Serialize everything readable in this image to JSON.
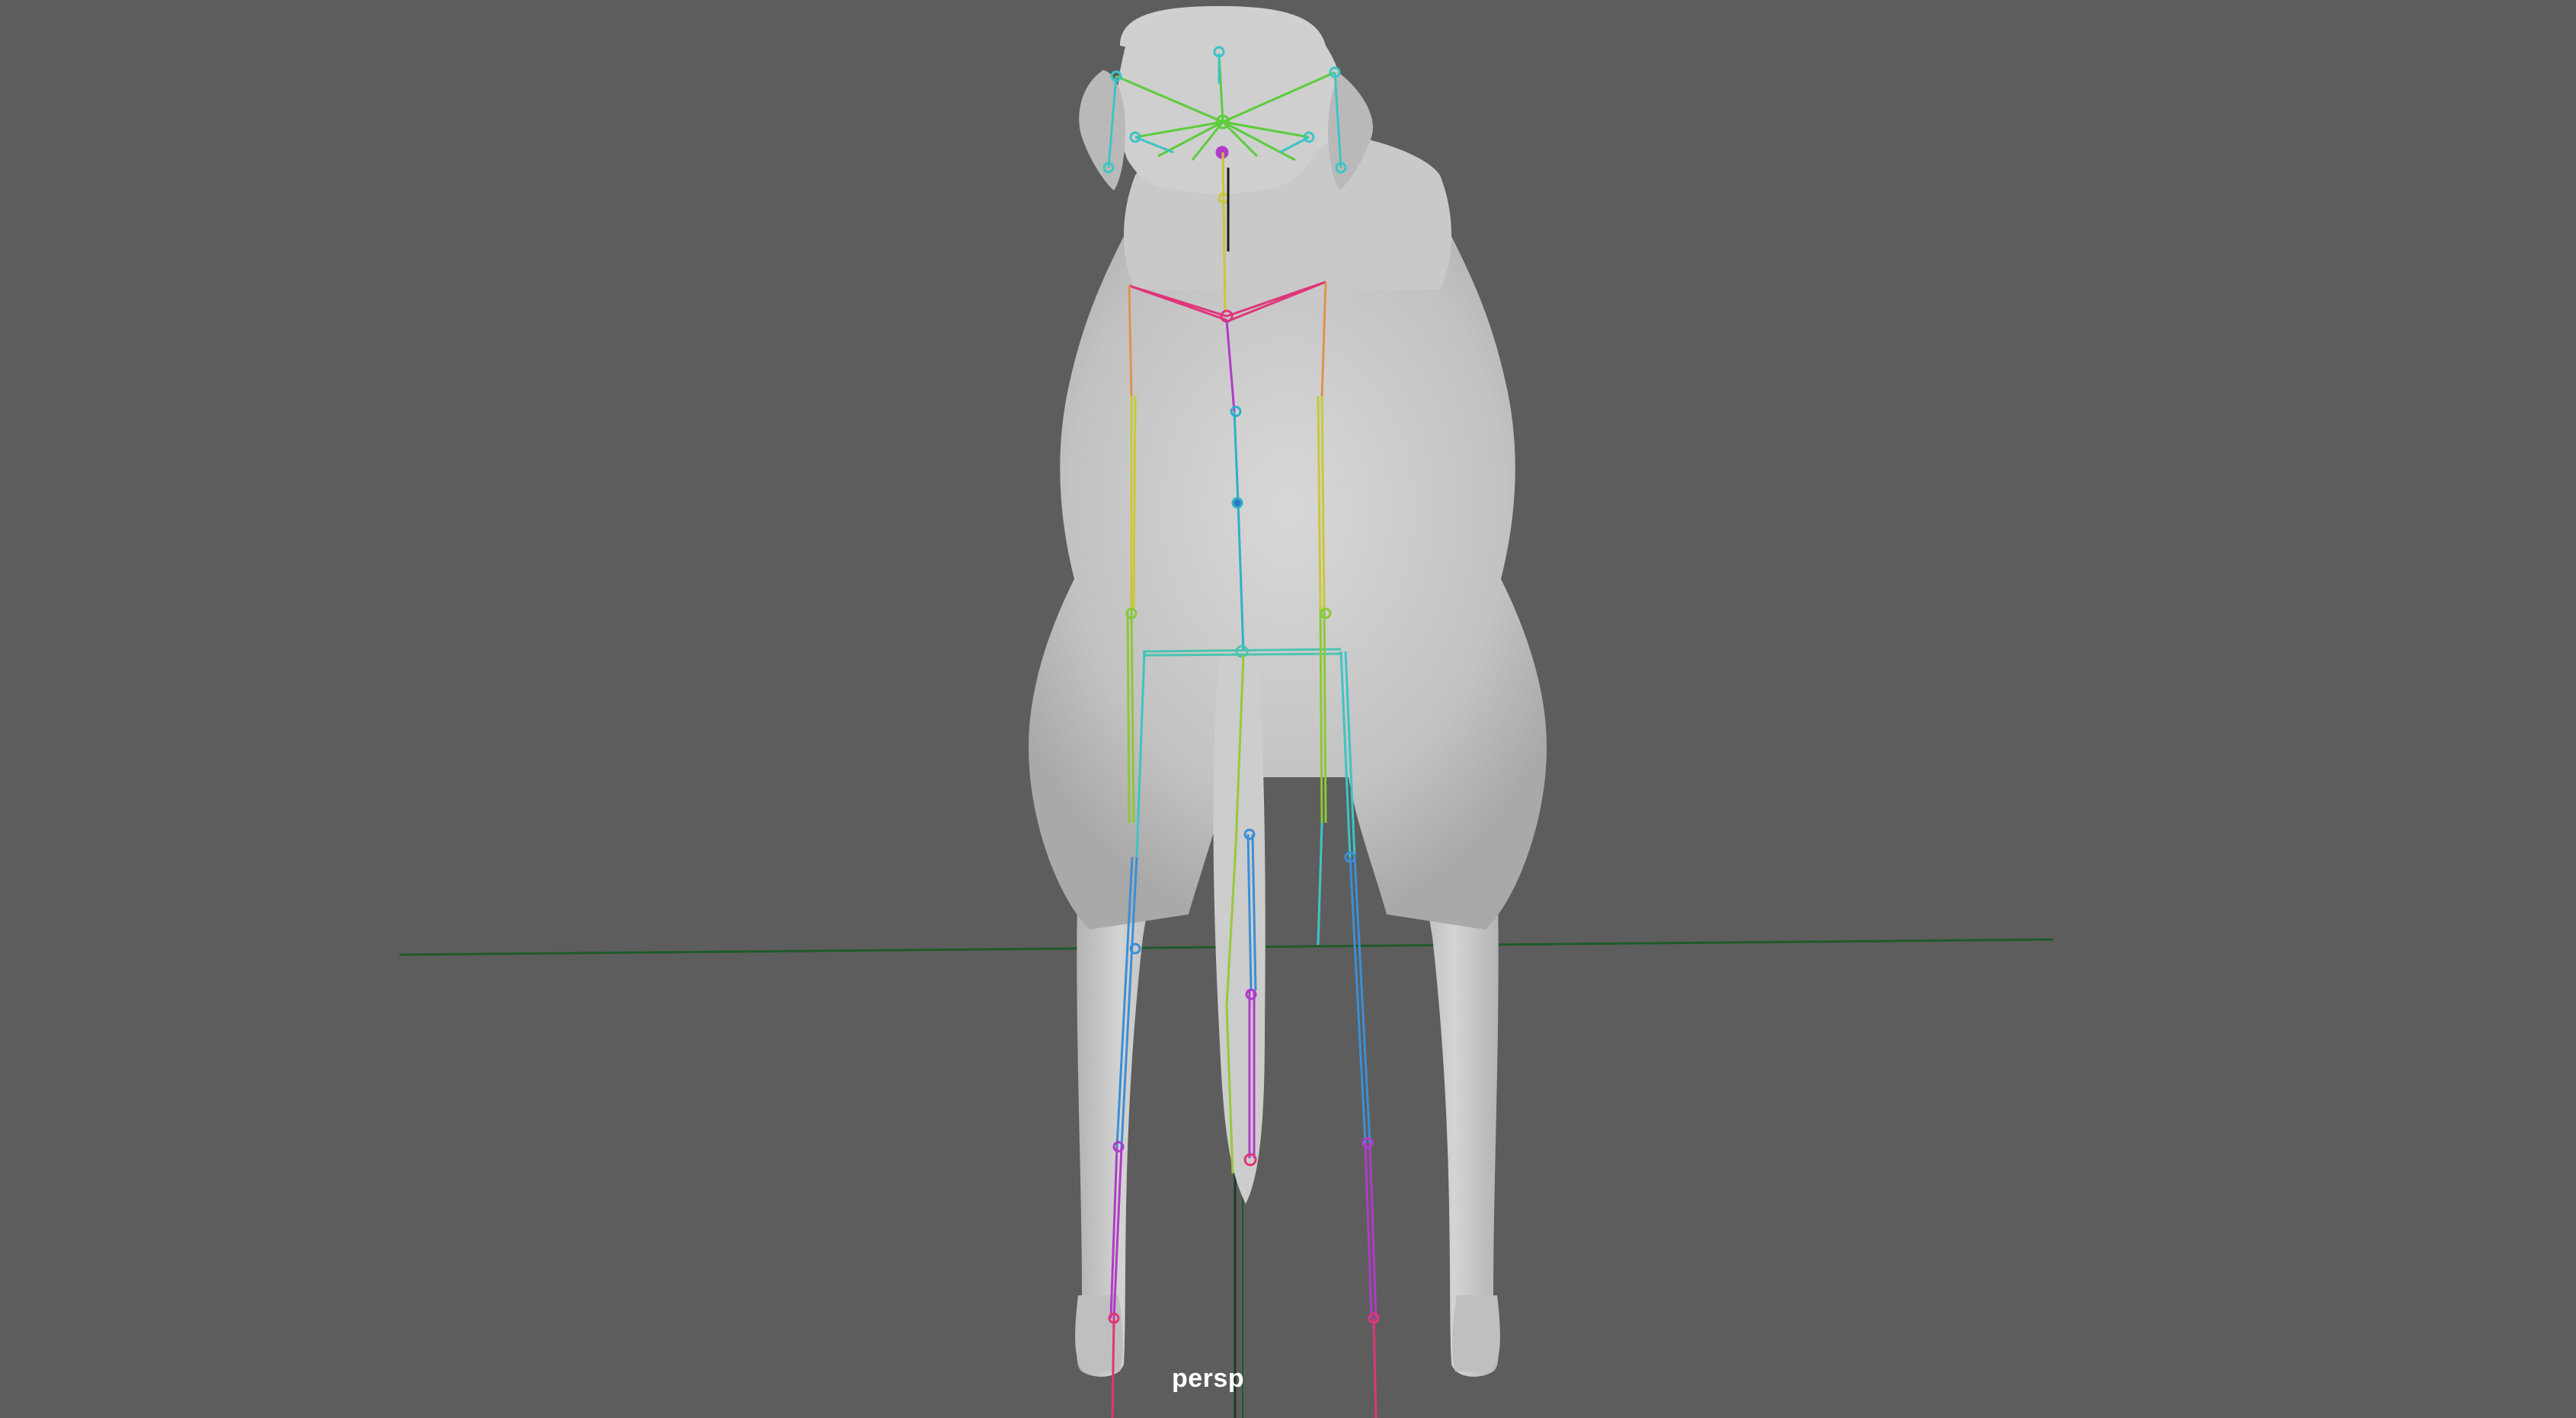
{
  "viewport": {
    "camera_name": "persp",
    "background_color": "#5d5d5d"
  },
  "scene": {
    "model": "dog",
    "view": "back",
    "mesh_color": "#c8c8c8",
    "ground_grid_color": "#1f5a2a",
    "skeleton_colors": {
      "head": "#5ccc3c",
      "ears": "#3ec4c4",
      "neck": "#c8c83a",
      "shoulders": "#e0357a",
      "upper_leg": "#c9c93a",
      "lower_leg": "#3b8fd6",
      "paw": "#b03cc8",
      "toe": "#e0357a",
      "hips": "#4cc4b0",
      "tail": "#9ac83a",
      "tail_tip": "#e0357a",
      "spine": "#2fb0c8"
    }
  }
}
